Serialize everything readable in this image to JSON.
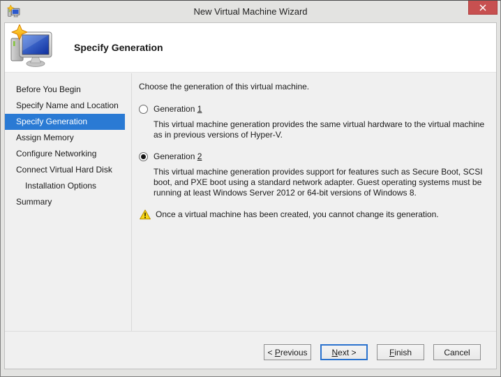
{
  "window": {
    "title": "New Virtual Machine Wizard"
  },
  "header": {
    "title": "Specify Generation"
  },
  "sidebar": {
    "items": [
      {
        "label": "Before You Begin",
        "selected": false
      },
      {
        "label": "Specify Name and Location",
        "selected": false
      },
      {
        "label": "Specify Generation",
        "selected": true
      },
      {
        "label": "Assign Memory",
        "selected": false
      },
      {
        "label": "Configure Networking",
        "selected": false
      },
      {
        "label": "Connect Virtual Hard Disk",
        "selected": false
      },
      {
        "label": "Installation Options",
        "selected": false,
        "indented": true
      },
      {
        "label": "Summary",
        "selected": false
      }
    ]
  },
  "main": {
    "instruction": "Choose the generation of this virtual machine.",
    "options": [
      {
        "label_text": "Generation ",
        "label_accel": "1",
        "selected": false,
        "description": "This virtual machine generation provides the same virtual hardware to the virtual machine as in previous versions of Hyper-V."
      },
      {
        "label_text": "Generation ",
        "label_accel": "2",
        "selected": true,
        "description": "This virtual machine generation provides support for features such as Secure Boot, SCSI boot, and PXE boot using a standard network adapter. Guest operating systems must be running at least Windows Server 2012 or 64-bit versions of Windows 8."
      }
    ],
    "warning": "Once a virtual machine has been created, you cannot change its generation."
  },
  "footer": {
    "buttons": [
      {
        "before": "< ",
        "accel": "P",
        "after": "revious",
        "default": false
      },
      {
        "before": "",
        "accel": "N",
        "after": "ext >",
        "default": true
      },
      {
        "before": "",
        "accel": "F",
        "after": "inish",
        "default": false
      },
      {
        "before": "Cancel",
        "accel": "",
        "after": "",
        "default": false
      }
    ]
  },
  "colors": {
    "selection_blue": "#2a7ad4",
    "close_red": "#c75050",
    "warning_yellow": "#f7d716",
    "default_button_border": "#2a72cd"
  }
}
